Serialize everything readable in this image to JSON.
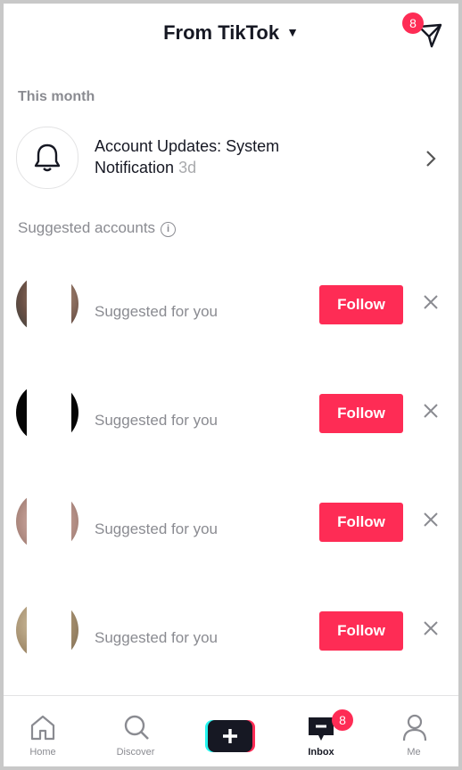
{
  "header": {
    "title": "From TikTok",
    "send_badge": "8"
  },
  "sections": {
    "this_month": "This month",
    "suggested": "Suggested accounts",
    "info_glyph": "i"
  },
  "notification": {
    "title_bold": "Account Updates:",
    "title_rest": " System",
    "subtitle": "Notification",
    "time": "3d"
  },
  "accounts": [
    {
      "subtitle": "Suggested for you",
      "follow": "Follow"
    },
    {
      "subtitle": "Suggested for you",
      "follow": "Follow"
    },
    {
      "subtitle": "Suggested for you",
      "follow": "Follow"
    },
    {
      "subtitle": "Suggested for you",
      "follow": "Follow"
    }
  ],
  "nav": {
    "home": "Home",
    "discover": "Discover",
    "inbox": "Inbox",
    "inbox_badge": "8",
    "me": "Me"
  },
  "colors": {
    "accent": "#fe2c55",
    "text": "#161823",
    "muted": "#8a8b91"
  }
}
